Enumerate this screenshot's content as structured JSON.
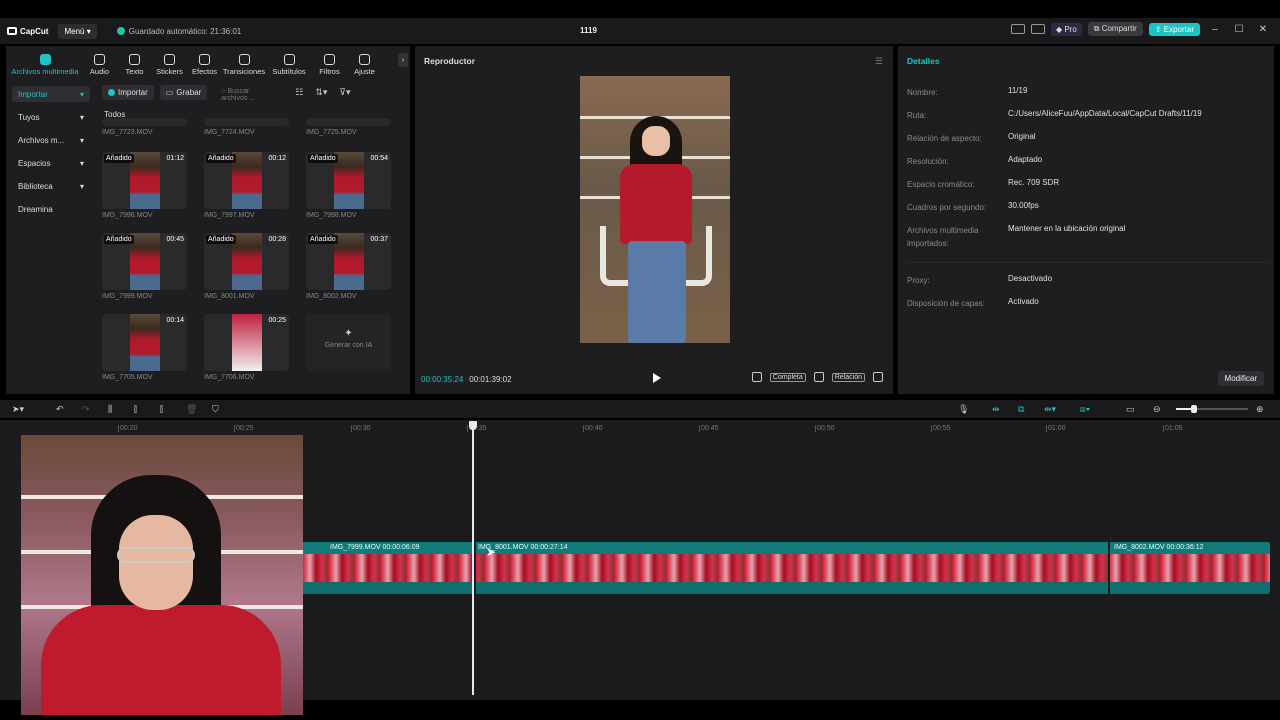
{
  "app": {
    "logo": "CapCut",
    "menu_label": "Menú",
    "autosave": "Guardado automático: 21:36:01",
    "project_title": "1119",
    "pro_label": "Pro",
    "share_label": "Compartir",
    "export_label": "Exportar",
    "accent_color": "#22c3c3"
  },
  "tools": [
    {
      "label": "Archivos multimedia",
      "icon": "media-icon"
    },
    {
      "label": "Audio",
      "icon": "audio-icon"
    },
    {
      "label": "Texto",
      "icon": "text-icon"
    },
    {
      "label": "Stickers",
      "icon": "sticker-icon"
    },
    {
      "label": "Efectos",
      "icon": "effects-icon"
    },
    {
      "label": "Transiciones",
      "icon": "transitions-icon"
    },
    {
      "label": "Subtítulos",
      "icon": "subtitles-icon"
    },
    {
      "label": "Filtros",
      "icon": "filters-icon"
    },
    {
      "label": "Ajuste",
      "icon": "adjust-icon"
    }
  ],
  "sidebar": {
    "items": [
      {
        "label": "Importar"
      },
      {
        "label": "Tuyos"
      },
      {
        "label": "Archivos m..."
      },
      {
        "label": "Espacios"
      },
      {
        "label": "Biblioteca"
      },
      {
        "label": "Dreamina"
      }
    ]
  },
  "media": {
    "import_btn": "Importar",
    "record_btn": "Grabar",
    "search_placeholder": "Buscar archivos ...",
    "filter_all": "Todos",
    "generate_ai": "Generar con IA",
    "top_row": [
      "IMG_7723.MOV",
      "IMG_7724.MOV",
      "IMG_7725.MOV"
    ],
    "items": [
      {
        "name": "IMG_7996.MOV",
        "badge": "Añadido",
        "duration": "01:12"
      },
      {
        "name": "IMG_7997.MOV",
        "badge": "Añadido",
        "duration": "00:12"
      },
      {
        "name": "IMG_7998.MOV",
        "badge": "Añadido",
        "duration": "00:54"
      },
      {
        "name": "IMG_7999.MOV",
        "badge": "Añadido",
        "duration": "00:45"
      },
      {
        "name": "IMG_8001.MOV",
        "badge": "Añadido",
        "duration": "00:28"
      },
      {
        "name": "IMG_8002.MOV",
        "badge": "Añadido",
        "duration": "00:37"
      },
      {
        "name": "IMG_7705.MOV",
        "badge": "",
        "duration": "00:14"
      },
      {
        "name": "IMG_7706.MOV",
        "badge": "",
        "duration": "00:25"
      }
    ]
  },
  "player": {
    "title": "Reproductor",
    "current_time": "00:00:35:24",
    "total_time": "00:01:39:02",
    "full_label": "Completa",
    "ratio_label": "Relación"
  },
  "details": {
    "title": "Detalles",
    "rows": [
      {
        "label": "Nombre:",
        "value": "11/19"
      },
      {
        "label": "Ruta:",
        "value": "C:/Users/AliceFuu/AppData/Local/CapCut Drafts/11/19"
      },
      {
        "label": "Relación de aspecto:",
        "value": "Original"
      },
      {
        "label": "Resolución:",
        "value": "Adaptado"
      },
      {
        "label": "Espacio cromático:",
        "value": "Rec. 709 SDR"
      },
      {
        "label": "Cuadros por segundo:",
        "value": "30.00fps"
      },
      {
        "label": "Archivos multimedia importados:",
        "value": "Mantener en la ubicación original"
      },
      {
        "label": "Proxy:",
        "value": "Desactivado"
      },
      {
        "label": "Disposición de capas:",
        "value": "Activado"
      }
    ],
    "modify_btn": "Modificar"
  },
  "timeline": {
    "ruler": [
      "00:20",
      "00:25",
      "00:30",
      "00:35",
      "00:40",
      "00:45",
      "00:50",
      "00:55",
      "01:00",
      "01:05"
    ],
    "clips": [
      {
        "label": "IMG_7999.MOV   00:00:06:09"
      },
      {
        "label": "IMG_8001.MOV   00:00:27:14"
      },
      {
        "label": "IMG_8002.MOV   00:00:36:12"
      }
    ]
  }
}
